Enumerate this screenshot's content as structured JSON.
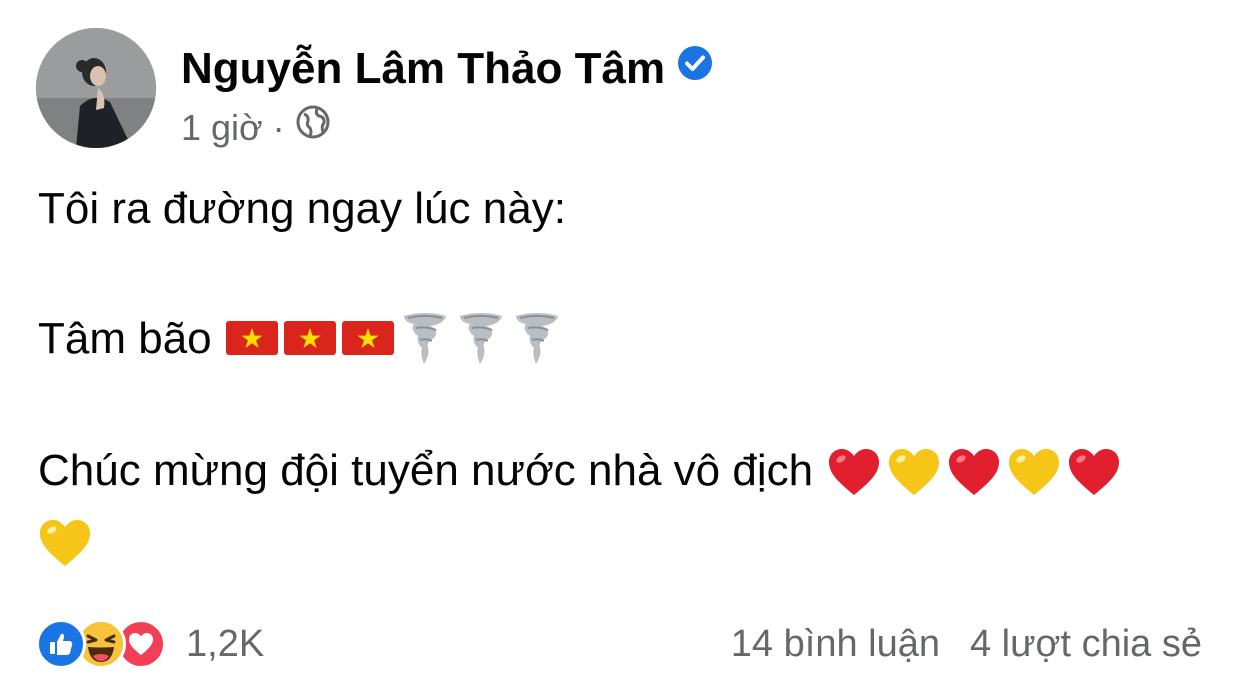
{
  "post": {
    "author": "Nguyễn Lâm Thảo Tâm",
    "verified": true,
    "time": "1 giờ",
    "separator": "·",
    "privacy_icon": "globe-icon",
    "lines": [
      "Tôi ra đường ngay lúc này:",
      "Tâm bão",
      "Chúc mừng đội tuyển nước nhà vô địch"
    ],
    "emojis": {
      "line2": [
        "vietnam-flag",
        "vietnam-flag",
        "vietnam-flag",
        "tornado",
        "tornado",
        "tornado"
      ],
      "line3": [
        "red-heart",
        "yellow-heart",
        "red-heart",
        "yellow-heart",
        "red-heart",
        "yellow-heart"
      ]
    }
  },
  "reactions": {
    "types": [
      "like",
      "haha",
      "love"
    ],
    "count": "1,2K"
  },
  "stats": {
    "comments": "14 bình luận",
    "shares": "4 lượt chia sẻ"
  },
  "colors": {
    "verified_blue": "#1b74e4",
    "secondary_text": "#65676b",
    "flag_red": "#da251d",
    "flag_star": "#ffdd00",
    "heart_red": "#e0202e",
    "heart_yellow": "#f5c518"
  }
}
